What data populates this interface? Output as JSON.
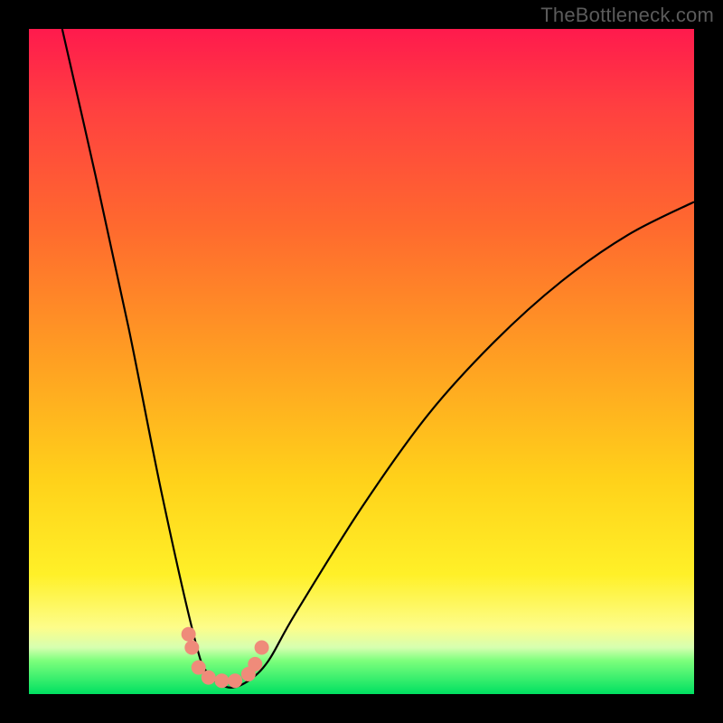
{
  "watermark": "TheBottleneck.com",
  "chart_data": {
    "type": "line",
    "title": "",
    "xlabel": "",
    "ylabel": "",
    "xlim": [
      0,
      100
    ],
    "ylim": [
      0,
      100
    ],
    "grid": false,
    "legend": false,
    "series": [
      {
        "name": "bottleneck-curve",
        "x": [
          5,
          10,
          15,
          20,
          25,
          27,
          30,
          33,
          36,
          40,
          50,
          60,
          70,
          80,
          90,
          100
        ],
        "values": [
          100,
          78,
          55,
          30,
          8,
          3,
          1,
          2,
          5,
          12,
          28,
          42,
          53,
          62,
          69,
          74
        ]
      }
    ],
    "markers": {
      "name": "highlight-points",
      "x": [
        24,
        24.5,
        25.5,
        27,
        29,
        31,
        33,
        34,
        35
      ],
      "values": [
        9,
        7,
        4,
        2.5,
        2,
        2,
        3,
        4.5,
        7
      ],
      "color": "#ef8b7a",
      "size": 10
    },
    "background": {
      "type": "vertical-gradient",
      "stops": [
        {
          "pos": 0,
          "color": "#ff1a4d"
        },
        {
          "pos": 50,
          "color": "#ffa022"
        },
        {
          "pos": 82,
          "color": "#fff028"
        },
        {
          "pos": 93,
          "color": "#d6ffb0"
        },
        {
          "pos": 100,
          "color": "#00e061"
        }
      ]
    }
  }
}
